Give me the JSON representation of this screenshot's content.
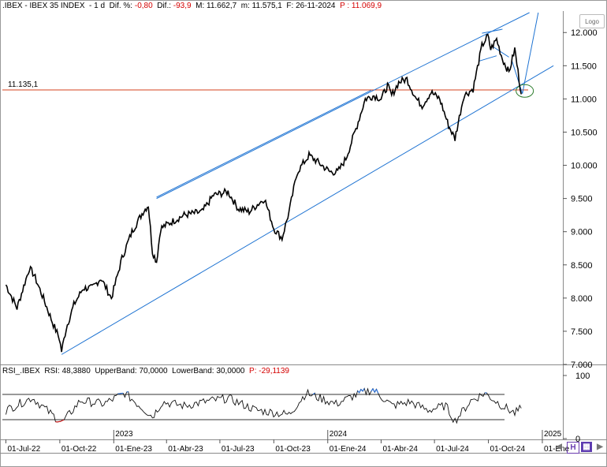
{
  "header": {
    "symbol": ".IBEX - IBEX 35 INDEX",
    "period": "1 d",
    "dif_pct_label": "Dif. %:",
    "dif_pct_value": "-0,80",
    "dif_label": "Dif.:",
    "dif_value": "-93,9",
    "max_label": "M: 11.662,7",
    "min_label": "m: 11.575,1",
    "date": "F: 26-11-2024",
    "price_label": "P : 11.069,9"
  },
  "logo_label": "Logo",
  "rsi_header": {
    "name": "RSI_.IBEX",
    "rsi": "RSI: 48,3880",
    "upper": "UpperBand: 70,0000",
    "lower": "LowerBand: 30,0000",
    "p": "P: -29,1139"
  },
  "colors": {
    "price": "#000000",
    "channel": "#1e73d2",
    "support": "#d4421c",
    "rsi_overbought": "#2a6fd6",
    "rsi_oversold": "#d02020",
    "header_red": "#d40000"
  },
  "chart_data": [
    {
      "type": "line",
      "title": ".IBEX - IBEX 35 INDEX",
      "x": [
        "2022-07-01",
        "2022-07-20",
        "2022-08-10",
        "2022-08-18",
        "2022-09-05",
        "2022-09-20",
        "2022-09-30",
        "2022-10-04",
        "2022-10-12",
        "2022-10-25",
        "2022-11-10",
        "2022-11-25",
        "2022-12-10",
        "2022-12-28",
        "2023-01-15",
        "2023-02-01",
        "2023-02-20",
        "2023-03-01",
        "2023-03-08",
        "2023-03-15",
        "2023-03-22",
        "2023-04-10",
        "2023-05-01",
        "2023-06-01",
        "2023-06-20",
        "2023-07-15",
        "2023-08-01",
        "2023-08-20",
        "2023-09-15",
        "2023-10-01",
        "2023-10-15",
        "2023-10-27",
        "2023-11-10",
        "2023-11-30",
        "2023-12-15",
        "2024-01-05",
        "2024-01-18",
        "2024-02-01",
        "2024-02-20",
        "2024-03-05",
        "2024-03-20",
        "2024-04-01",
        "2024-04-12",
        "2024-04-19",
        "2024-05-01",
        "2024-05-15",
        "2024-05-31",
        "2024-06-10",
        "2024-06-25",
        "2024-07-10",
        "2024-07-25",
        "2024-08-05",
        "2024-08-20",
        "2024-09-05",
        "2024-09-20",
        "2024-09-30",
        "2024-10-05",
        "2024-10-15",
        "2024-10-25",
        "2024-11-05",
        "2024-11-15",
        "2024-11-26"
      ],
      "values": [
        8200,
        7850,
        8450,
        8350,
        7950,
        7600,
        7400,
        7200,
        7550,
        7900,
        8150,
        8150,
        8300,
        8000,
        8600,
        9000,
        9300,
        9400,
        8700,
        8550,
        9050,
        9150,
        9250,
        9300,
        9550,
        9600,
        9350,
        9300,
        9500,
        9050,
        8900,
        9300,
        9900,
        10150,
        10050,
        9900,
        9900,
        10100,
        10600,
        11000,
        11050,
        11000,
        11200,
        11050,
        11250,
        11300,
        11000,
        10900,
        11100,
        11000,
        10600,
        10400,
        11050,
        11150,
        11800,
        11950,
        11750,
        11900,
        11600,
        11400,
        11750,
        11069.9
      ],
      "ylim": [
        7000,
        12300
      ],
      "xlim": [
        "2022-06-25",
        "2025-02-05"
      ],
      "yticks": [
        "7.000",
        "7.500",
        "8.000",
        "8.500",
        "9.000",
        "9.500",
        "10.000",
        "10.500",
        "11.000",
        "11.500",
        "12.000"
      ],
      "ytick_values": [
        7000,
        7500,
        8000,
        8500,
        9000,
        9500,
        10000,
        10500,
        11000,
        11500,
        12000
      ],
      "xtick_labels": [
        "01-Jul-22",
        "01-Oct-22",
        "01-Ene-23",
        "01-Abr-23",
        "01-Jul-23",
        "01-Oct-23",
        "01-Ene-24",
        "01-Abr-24",
        "01-Jul-24",
        "01-Oct-24",
        "01-Ene"
      ],
      "xtick_dates": [
        "2022-07-01",
        "2022-10-01",
        "2023-01-01",
        "2023-04-01",
        "2023-07-01",
        "2023-10-01",
        "2024-01-01",
        "2024-04-01",
        "2024-07-01",
        "2024-10-01",
        "2025-01-01"
      ],
      "year_labels": [
        "2023",
        "2024",
        "2025"
      ],
      "year_dates": [
        "2023-01-01",
        "2024-01-01",
        "2025-01-01"
      ],
      "support_level": 11135.1,
      "support_label": "11.135,1",
      "price_tag": "11.069,9",
      "channel_lower": [
        [
          "2022-10-04",
          7150
        ],
        [
          "2025-01-20",
          11500
        ]
      ],
      "channel_upper": [
        [
          "2023-03-15",
          9500
        ],
        [
          "2024-12-10",
          12300
        ]
      ],
      "upper_touch": [
        [
          "2023-03-15",
          9520
        ],
        [
          "2024-03-15",
          11130
        ]
      ],
      "triangle_upper": [
        [
          "2024-09-20",
          11990
        ],
        [
          "2024-10-25",
          12050
        ]
      ],
      "triangle_lower": [
        [
          "2024-09-15",
          11570
        ],
        [
          "2024-10-15",
          11650
        ]
      ],
      "triangle_apex": [
        [
          "2024-10-10",
          11780
        ],
        [
          "2024-11-05",
          11630
        ]
      ],
      "projection": [
        [
          "2024-11-10",
          11580
        ],
        [
          "2024-11-28",
          11080
        ],
        [
          "2024-12-25",
          12300
        ]
      ],
      "target_ellipse": [
        "2024-12-02",
        11120
      ],
      "grid": false
    },
    {
      "type": "line",
      "title": "RSI_.IBEX",
      "ylim": [
        0,
        100
      ],
      "yticks": [
        "0",
        "100"
      ],
      "ytick_values": [
        0,
        100
      ],
      "bands": [
        70,
        30
      ],
      "x": [
        "2022-07-01",
        "2022-08-15",
        "2022-09-15",
        "2022-10-05",
        "2022-11-05",
        "2022-12-15",
        "2023-01-20",
        "2023-03-08",
        "2023-03-25",
        "2023-05-01",
        "2023-06-15",
        "2023-07-15",
        "2023-09-01",
        "2023-10-27",
        "2023-11-25",
        "2024-01-15",
        "2024-02-15",
        "2024-03-18",
        "2024-04-20",
        "2024-05-20",
        "2024-06-20",
        "2024-07-20",
        "2024-08-05",
        "2024-09-01",
        "2024-09-25",
        "2024-10-20",
        "2024-11-15",
        "2024-11-26"
      ],
      "values": [
        45,
        65,
        40,
        25,
        60,
        55,
        72,
        35,
        58,
        52,
        60,
        64,
        45,
        38,
        72,
        55,
        68,
        78,
        52,
        58,
        45,
        52,
        28,
        60,
        72,
        55,
        40,
        48
      ]
    }
  ]
}
